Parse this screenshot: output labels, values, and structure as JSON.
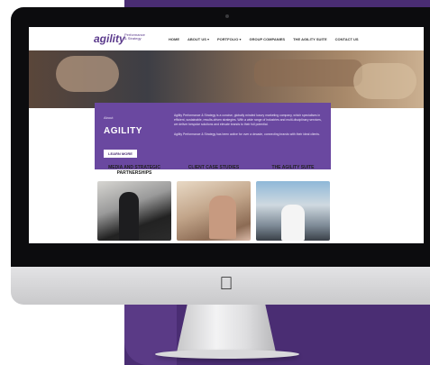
{
  "nav": {
    "logo": "agility",
    "logo_sub": "Performance & Strategy",
    "links": [
      "HOME",
      "ABOUT US ▾",
      "PORTFOLIO ▾",
      "GROUP COMPANIES",
      "THE AGILITY SUITE",
      "CONTACT US"
    ]
  },
  "hero": {
    "small_label": "About",
    "title": "AGILITY",
    "button_label": "LEARN MORE",
    "paragraph1": "Agility Performance & Strategy is a concise, globally minded luxury marketing company, which specialises in efficient, sustainable, results-driven strategies. With a wide range of industries and multi-disciplinary services, we deliver bespoke solutions and elevate brands to their full potential.",
    "paragraph2": "Agility Performance & Strategy has been active for over a decade, connecting brands with their ideal clients."
  },
  "columns": [
    {
      "title": "MEDIA AND STRATEGIC PARTNERSHIPS"
    },
    {
      "title": "CLIENT CASE STUDIES"
    },
    {
      "title": "THE AGILITY SUITE"
    }
  ],
  "icons": {
    "apple": "apple-logo-icon"
  }
}
